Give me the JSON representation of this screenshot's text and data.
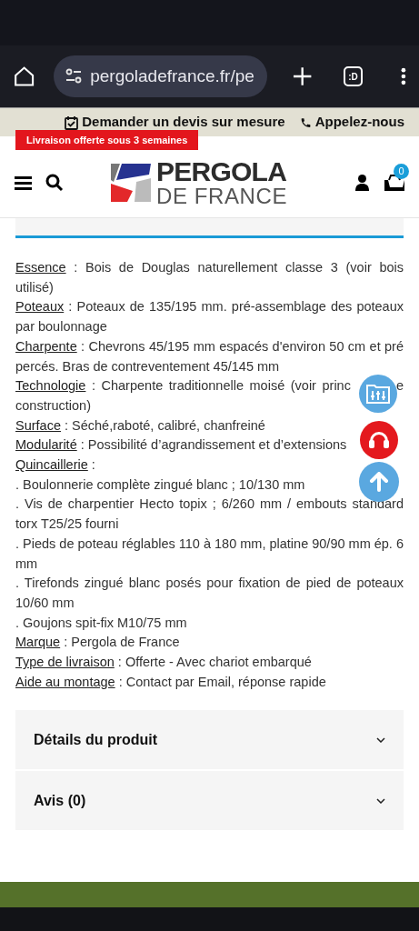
{
  "browser": {
    "url": "pergoladefrance.fr/pe",
    "tab_count": ":D"
  },
  "top_bar": {
    "quote": "Demander un devis sur mesure",
    "call": "Appelez-nous"
  },
  "promo_badge": "Livraison offerte sous 3 semaines",
  "header": {
    "logo_top": "PERGOLA",
    "logo_bottom": "DE FRANCE",
    "cart_count": "0"
  },
  "specs": [
    {
      "kind": "spec",
      "label": "Essence",
      "text": " : Bois de Douglas naturellement classe 3 (voir bois utilisé)"
    },
    {
      "kind": "spec",
      "label": "Poteaux",
      "text": " : Poteaux de 135/195 mm. pré-assemblage des poteaux par boulonnage"
    },
    {
      "kind": "spec",
      "label": "Charpente",
      "text": " : Chevrons 45/195 mm espacés d'environ 50 cm et pré percés. Bras de contreventement 45/145 mm"
    },
    {
      "kind": "covered",
      "label": "Technologie",
      "text": " : Charpente traditionnelle moisé (voir princ",
      "tail": "e",
      "continuation": "construction)"
    },
    {
      "kind": "spec",
      "label": "Surface",
      "text": " : Séché,raboté, calibré, chanfreiné"
    },
    {
      "kind": "spec",
      "label": "Modularité",
      "text": " : Possibilité d’agrandissement et d’extensions"
    },
    {
      "kind": "spec",
      "label": "Quincaillerie",
      "text": " :"
    },
    {
      "kind": "bullet",
      "text": ". Boulonnerie complète zingué blanc ; 10/130 mm"
    },
    {
      "kind": "bullet",
      "text": ". Vis de charpentier Hecto topix ; 6/260 mm / embouts standard torx T25/25 fourni"
    },
    {
      "kind": "bullet",
      "text": ". Pieds de poteau réglables 110 à 180 mm, platine 90/90 mm ép. 6 mm"
    },
    {
      "kind": "bullet",
      "text": ". Tirefonds zingué blanc posés pour fixation de pied de poteaux 10/60 mm"
    },
    {
      "kind": "bullet",
      "text": ". Goujons spit-fix M10/75 mm"
    },
    {
      "kind": "spec",
      "label": "Marque",
      "text": " : Pergola de France"
    },
    {
      "kind": "spec",
      "label": "Type de livraison",
      "text": " : Offerte - Avec chariot embarqué"
    },
    {
      "kind": "spec",
      "label": "Aide au montage",
      "text": " : Contact par Email, réponse rapide"
    }
  ],
  "accordion": [
    {
      "title": "Détails du produit",
      "expanded": false
    },
    {
      "title": "Avis (0)",
      "expanded": false
    }
  ]
}
